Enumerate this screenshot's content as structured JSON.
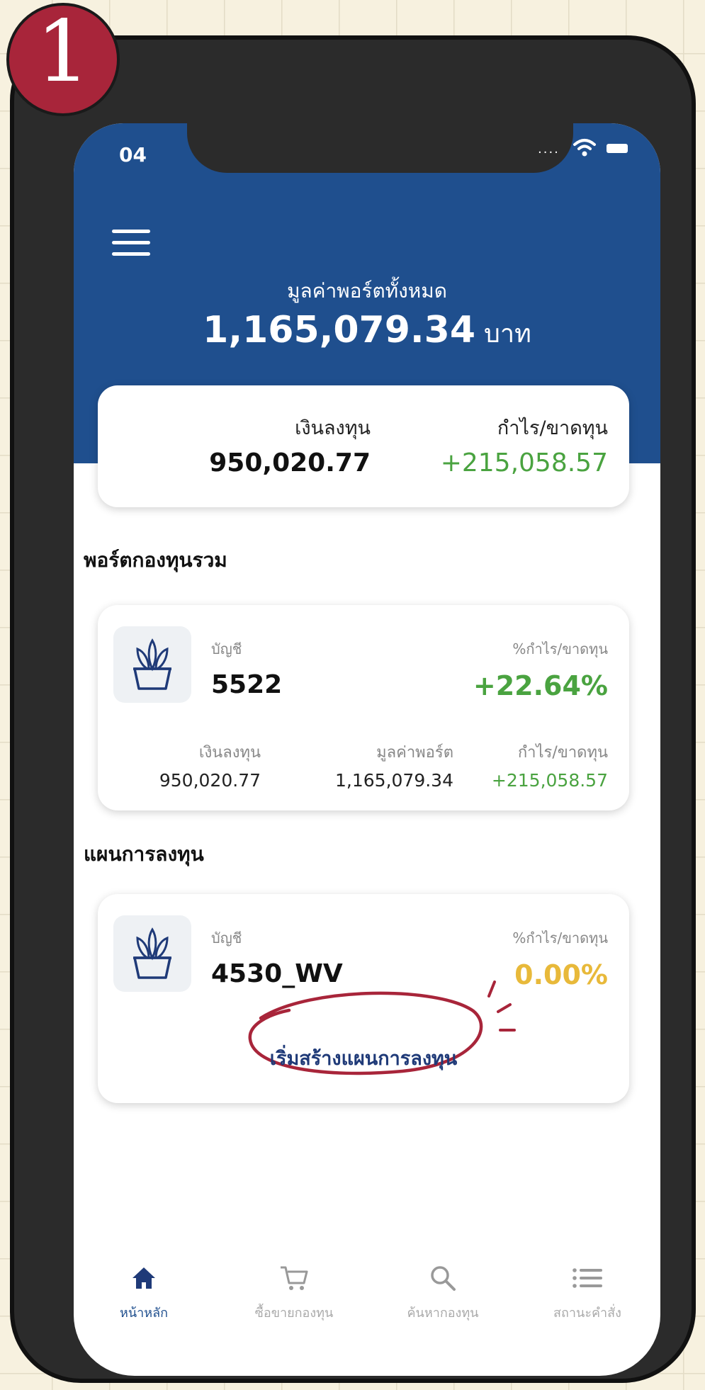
{
  "status": {
    "time": "04",
    "signal": "...."
  },
  "header": {
    "total_label": "มูลค่าพอร์ตทั้งหมด",
    "total_value": "1,165,079.34",
    "total_unit": "บาท"
  },
  "summary": {
    "invest_label": "เงินลงทุน",
    "invest_value": "950,020.77",
    "profit_label": "กำไร/ขาดทุน",
    "profit_value": "+215,058.57"
  },
  "portfolio": {
    "section_title": "พอร์ตกองทุนรวม",
    "account_label": "บัญชี",
    "account_number": "5522",
    "pct_label": "%กำไร/ขาดทุน",
    "pct_value": "+22.64%",
    "details": [
      {
        "label": "เงินลงทุน",
        "value": "950,020.77"
      },
      {
        "label": "มูลค่าพอร์ต",
        "value": "1,165,079.34"
      },
      {
        "label": "กำไร/ขาดทุน",
        "value": "+215,058.57"
      }
    ]
  },
  "plan": {
    "section_title": "แผนการลงทุน",
    "account_label": "บัญชี",
    "account_number": "4530_WV",
    "pct_label": "%กำไร/ขาดทุน",
    "pct_value": "0.00%",
    "start_button": "เริ่มสร้างแผนการลงทุน"
  },
  "nav": [
    {
      "label": "หน้าหลัก",
      "icon": "home-icon",
      "active": true
    },
    {
      "label": "ซื้อขายกองทุน",
      "icon": "cart-icon",
      "active": false
    },
    {
      "label": "ค้นหากองทุน",
      "icon": "search-icon",
      "active": false
    },
    {
      "label": "สถานะคำสั่ง",
      "icon": "list-icon",
      "active": false
    }
  ],
  "annotation": {
    "step_number": "1"
  },
  "colors": {
    "header_blue": "#1f4f8e",
    "positive_green": "#4aa340",
    "neutral_yellow": "#e8b93a",
    "annotation_red": "#a8253a"
  }
}
